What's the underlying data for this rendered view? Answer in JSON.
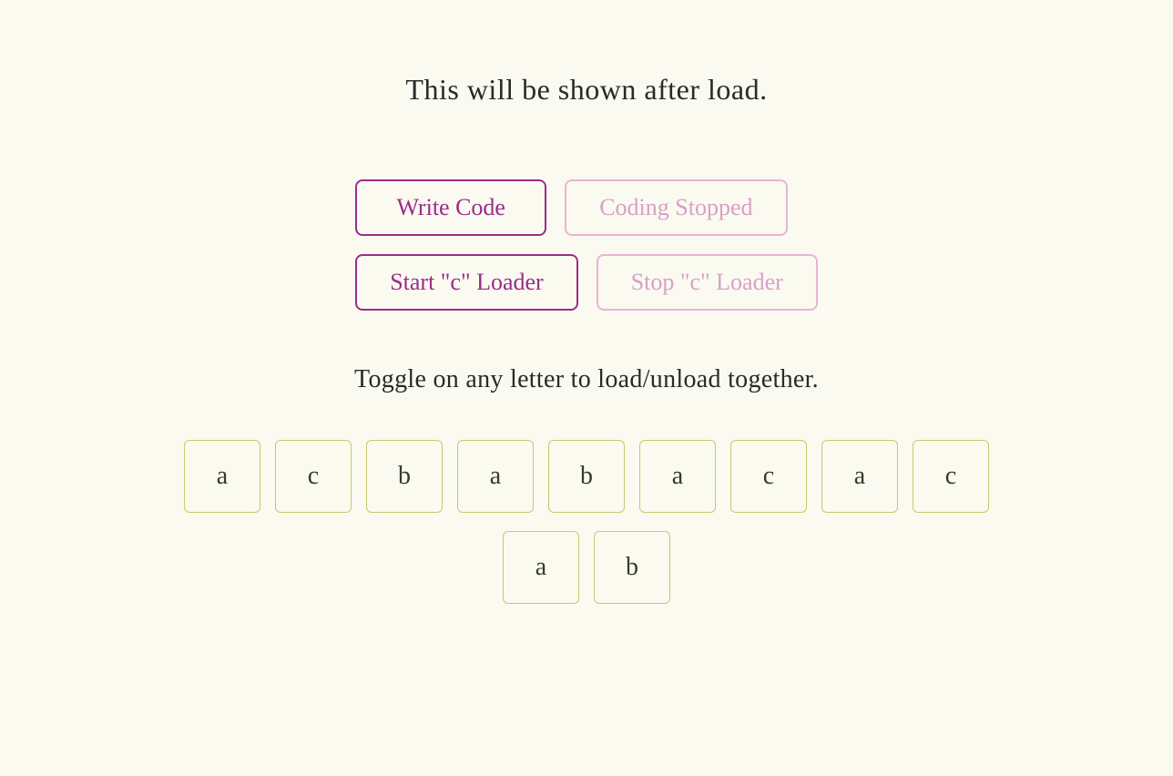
{
  "header": {
    "title": "This will be shown after load."
  },
  "buttons": {
    "write_code": "Write Code",
    "coding_stopped": "Coding Stopped",
    "start_loader": "Start \"c\" Loader",
    "stop_loader": "Stop \"c\" Loader"
  },
  "toggle_text": "Toggle on any letter to load/unload together.",
  "letter_rows": {
    "row1": [
      "a",
      "c",
      "b",
      "a",
      "b",
      "a",
      "c",
      "a",
      "c"
    ],
    "row2": [
      "a",
      "b"
    ]
  }
}
